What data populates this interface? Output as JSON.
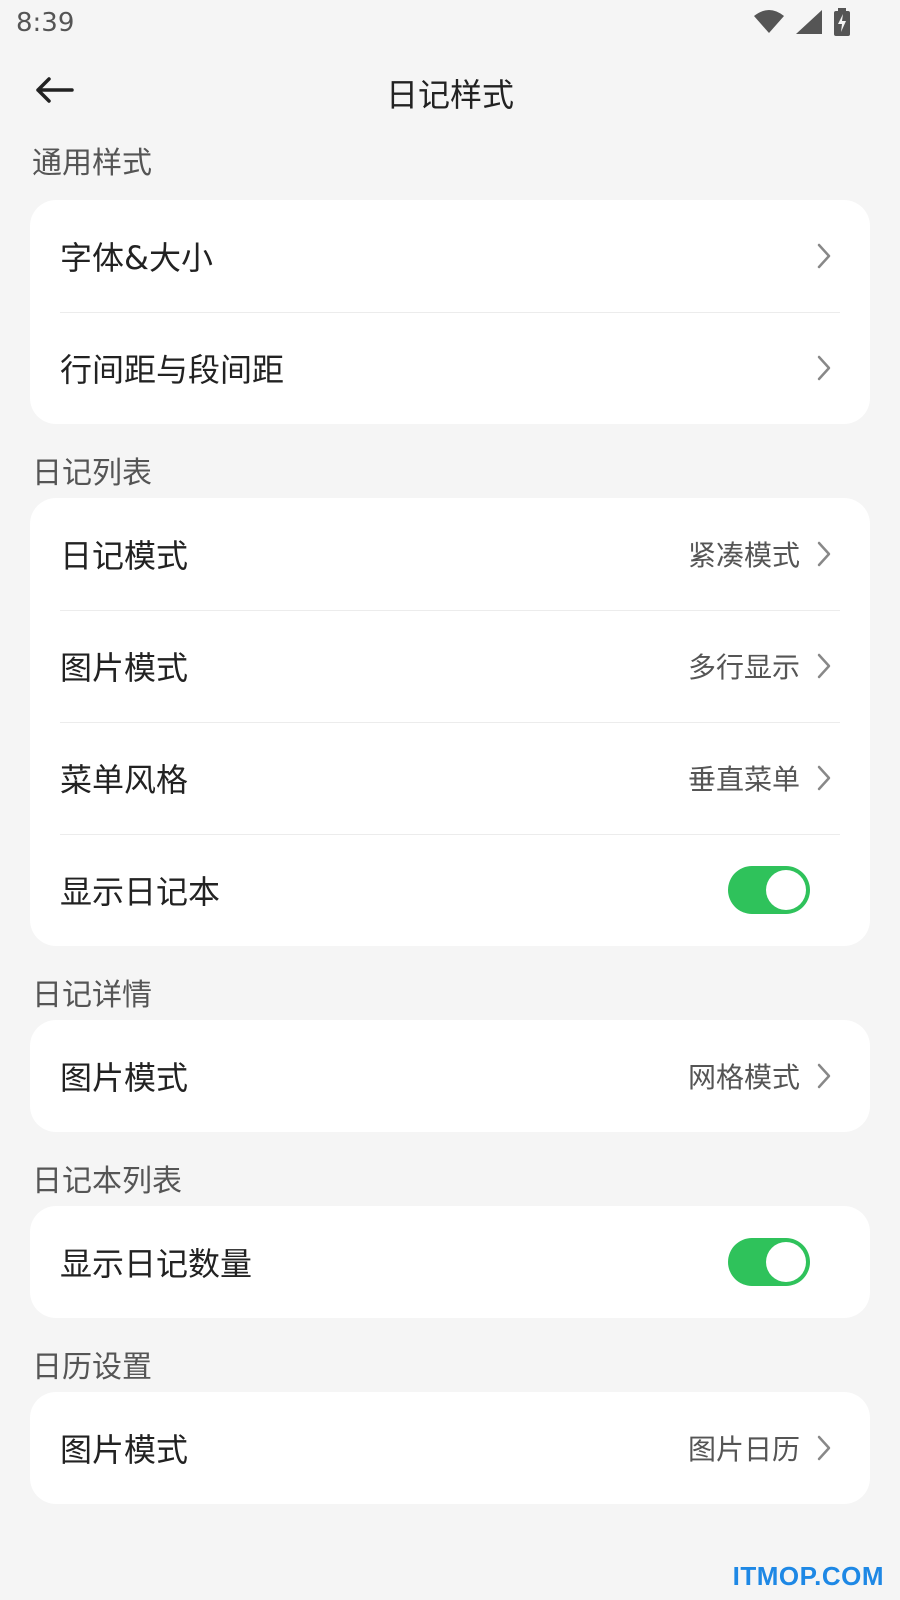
{
  "status_bar": {
    "time": "8:39",
    "icons": [
      "wifi-icon",
      "signal-icon",
      "battery-charging-icon"
    ]
  },
  "app_bar": {
    "back_icon": "arrow-left-icon",
    "title": "日记样式"
  },
  "sections": {
    "general": {
      "title": "通用样式",
      "items": [
        {
          "label": "字体&大小"
        },
        {
          "label": "行间距与段间距"
        }
      ]
    },
    "diary_list": {
      "title": "日记列表",
      "items": [
        {
          "label": "日记模式",
          "value": "紧凑模式"
        },
        {
          "label": "图片模式",
          "value": "多行显示"
        },
        {
          "label": "菜单风格",
          "value": "垂直菜单"
        },
        {
          "label": "显示日记本",
          "toggle": true
        }
      ]
    },
    "diary_detail": {
      "title": "日记详情",
      "items": [
        {
          "label": "图片模式",
          "value": "网格模式"
        }
      ]
    },
    "notebook_list": {
      "title": "日记本列表",
      "items": [
        {
          "label": "显示日记数量",
          "toggle": true
        }
      ]
    },
    "calendar": {
      "title": "日历设置",
      "items": [
        {
          "label": "图片模式",
          "value": "图片日历"
        }
      ]
    }
  },
  "colors": {
    "background": "#f5f5f5",
    "card": "#ffffff",
    "toggle_on": "#2fc25b",
    "watermark": "#1e88e5"
  },
  "watermark": "ITMOP.COM"
}
